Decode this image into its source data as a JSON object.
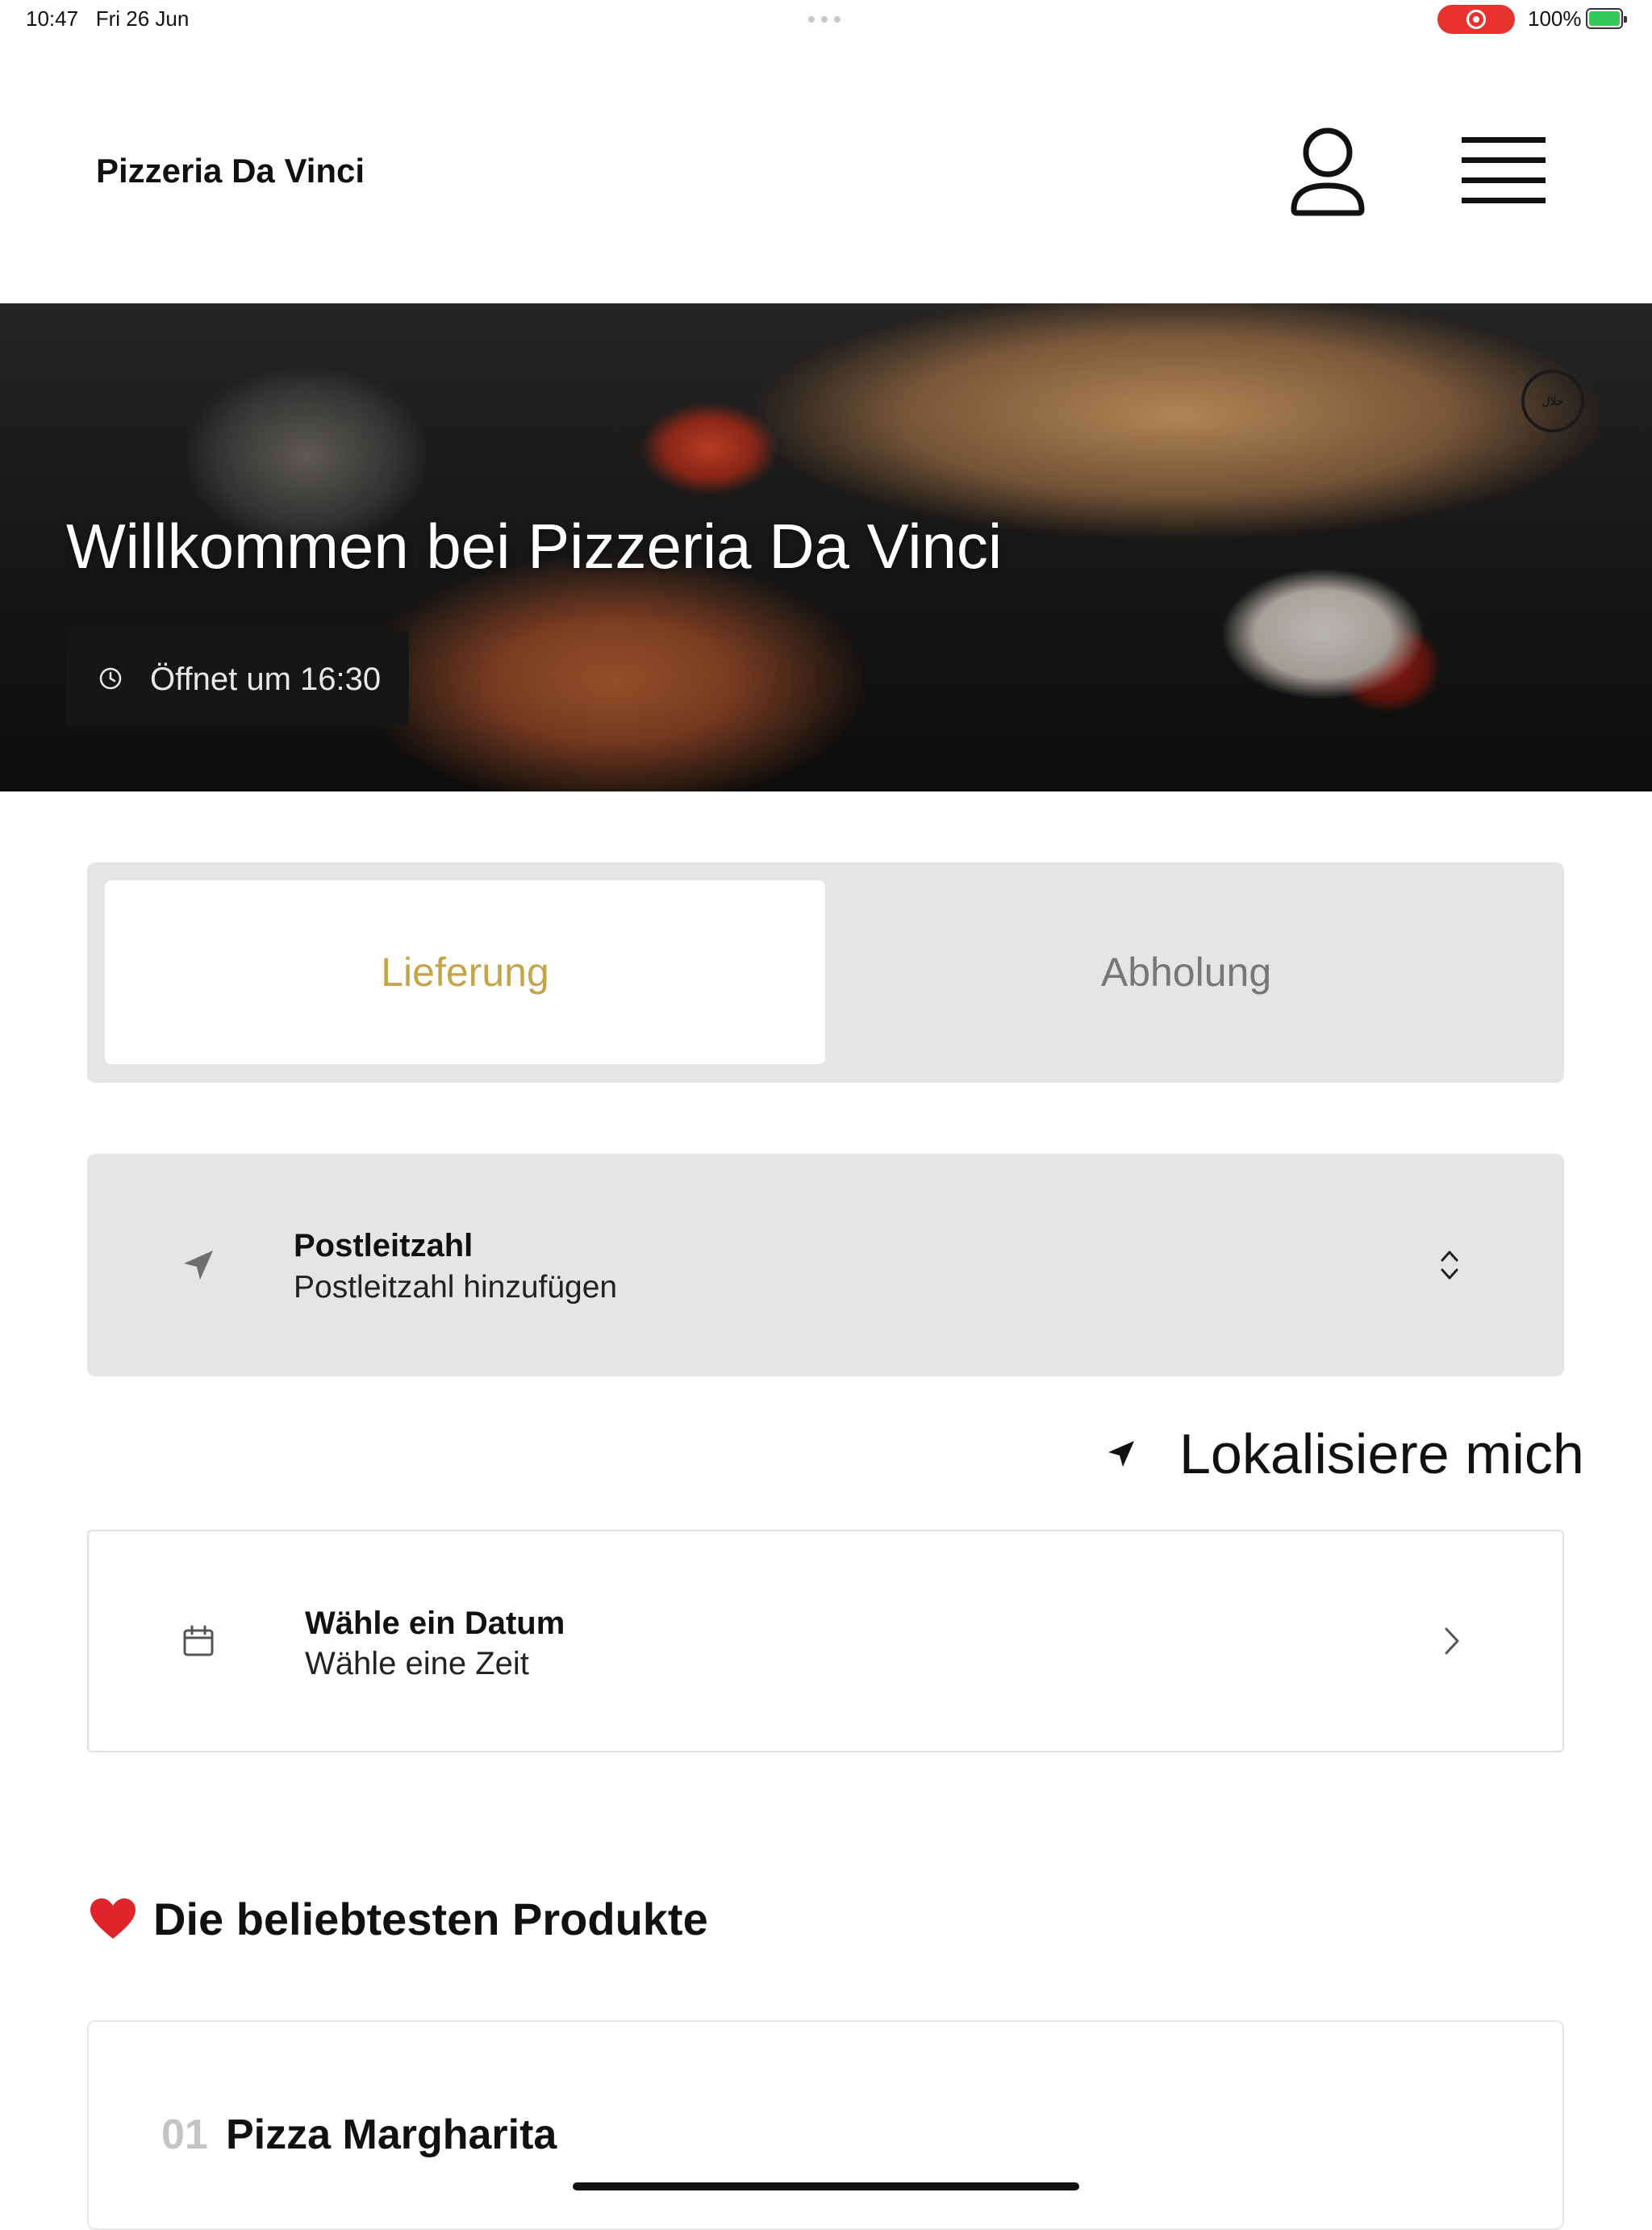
{
  "status_bar": {
    "time": "10:47",
    "date": "Fri 26 Jun",
    "battery": "100%",
    "recording_color": "#e8322e",
    "battery_color": "#34c759"
  },
  "header": {
    "brand": "Pizzeria Da Vinci",
    "icons": [
      "user-icon",
      "menu-icon"
    ]
  },
  "hero": {
    "title": "Willkommen bei Pizzeria Da Vinci",
    "opening": "Öffnet um 16:30",
    "badge": "halal-badge"
  },
  "order_mode": {
    "tabs": [
      {
        "label": "Lieferung",
        "active": true
      },
      {
        "label": "Abholung",
        "active": false
      }
    ],
    "accent_color": "#c4a54a"
  },
  "postal": {
    "title": "Postleitzahl",
    "placeholder": "Postleitzahl hinzufügen"
  },
  "locate": {
    "label": "Lokalisiere mich"
  },
  "schedule": {
    "title": "Wähle ein Datum",
    "subtitle": "Wähle eine Zeit"
  },
  "popular": {
    "title": "Die beliebtesten Produkte",
    "icon": "heart-icon",
    "items": [
      {
        "rank": "01",
        "name": "Pizza Margharita"
      }
    ]
  }
}
